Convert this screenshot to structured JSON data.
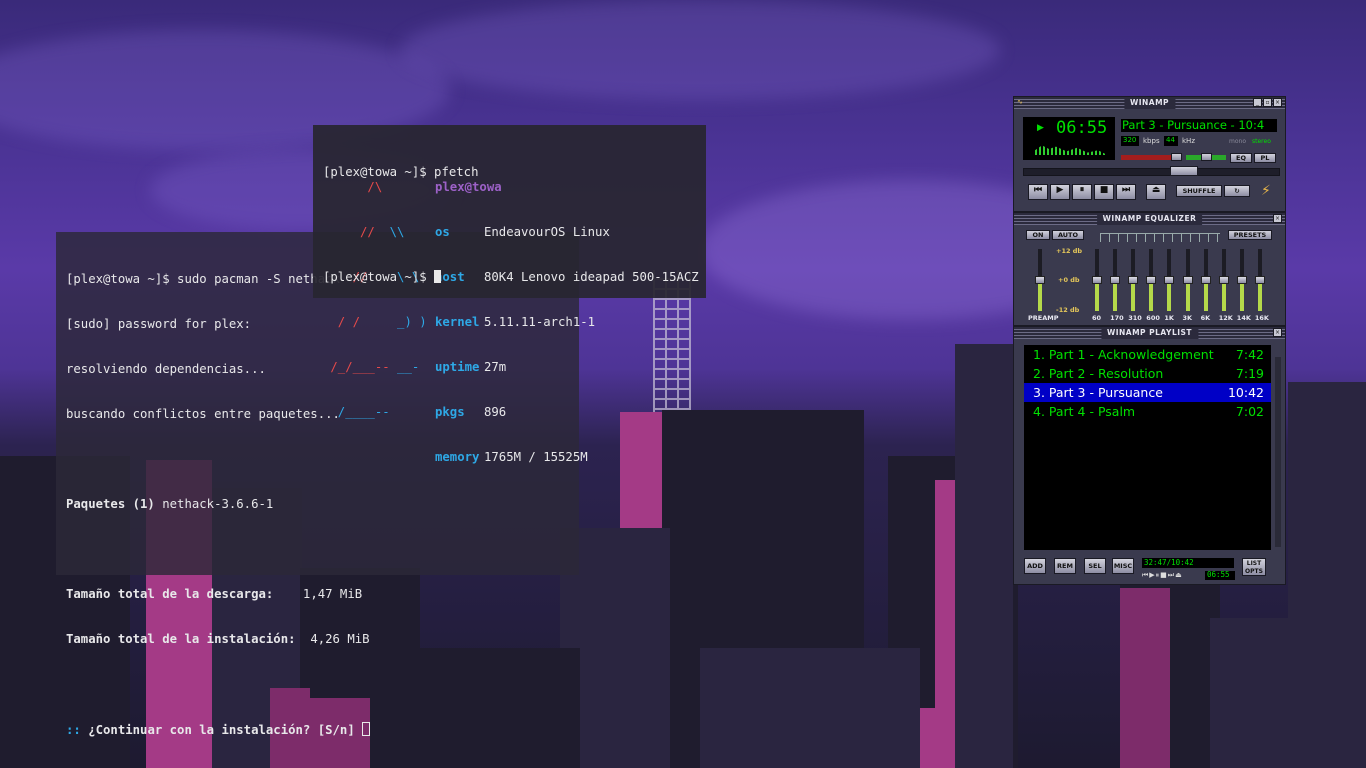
{
  "terminal_pacman": {
    "lines": [
      "[plex@towa ~]$ sudo pacman -S nethack",
      "[sudo] password for plex:",
      "resolviendo dependencias...",
      "buscando conflictos entre paquetes...",
      "",
      "Paquetes (1) nethack-3.6.6-1",
      "",
      "Tamaño total de la descarga:    1,47 MiB",
      "Tamaño total de la instalación:  4,26 MiB",
      "",
      ":: ¿Continuar con la instalación? [S/n] "
    ],
    "packages_label": "Paquetes (1)",
    "packages_value": " nethack-3.6.6-1",
    "download_label": "Tamaño total de la descarga:",
    "download_value": "    1,47 MiB",
    "install_label": "Tamaño total de la instalación:",
    "install_value": "  4,26 MiB",
    "prompt_prefix": "::",
    "prompt_text": " ¿Continuar con la instalación? [S/n] "
  },
  "terminal_pfetch": {
    "command": "[plex@towa ~]$ pfetch",
    "logo": [
      "      /\\",
      "     //  \\\\",
      "    //    \\ \\",
      "  / /     _) )",
      " /_/___-- __-",
      "  /____--"
    ],
    "user": "plex@towa",
    "info": [
      {
        "key": "os",
        "value": "EndeavourOS Linux"
      },
      {
        "key": "host",
        "value": "80K4 Lenovo ideapad 500-15ACZ"
      },
      {
        "key": "kernel",
        "value": "5.11.11-arch1-1"
      },
      {
        "key": "uptime",
        "value": "27m"
      },
      {
        "key": "pkgs",
        "value": "896"
      },
      {
        "key": "memory",
        "value": "1765M / 15525M"
      }
    ],
    "prompt": "[plex@towa ~]$ "
  },
  "winamp": {
    "main_title": "WINAMP",
    "time": "06:55",
    "song_title": "Part 3 - Pursuance - 10:4",
    "kbps": "320",
    "kbps_label": "kbps",
    "khz": "44",
    "khz_label": "kHz",
    "mono_label": "mono",
    "stereo_label": "stereo",
    "eq_btn": "EQ",
    "pl_btn": "PL",
    "shuffle_label": "SHUFFLE",
    "eq_title": "WINAMP EQUALIZER",
    "on_label": "ON",
    "auto_label": "AUTO",
    "presets_label": "PRESETS",
    "db_plus": "+12 db",
    "db_zero": "+0 db",
    "db_minus": "-12 db",
    "preamp_label": "PREAMP",
    "bands": [
      "60",
      "170",
      "310",
      "600",
      "1K",
      "3K",
      "6K",
      "12K",
      "14K",
      "16K"
    ],
    "pl_title": "WINAMP PLAYLIST",
    "playlist": [
      {
        "title": "1. Part 1 - Acknowledgement",
        "time": "7:42"
      },
      {
        "title": "2. Part 2 - Resolution",
        "time": "7:19"
      },
      {
        "title": "3. Part 3 - Pursuance",
        "time": "10:42"
      },
      {
        "title": "4. Part 4 - Psalm",
        "time": "7:02"
      }
    ],
    "selected_index": 2,
    "add_label": "ADD",
    "rem_label": "REM",
    "sel_label": "SEL",
    "misc_label": "MISC",
    "pl_time": "32:47/10:42",
    "pl_mini_time": "06:55",
    "list_opts": "LIST OPTS",
    "accent": "#00e000",
    "selected_bg": "#0000c6"
  }
}
